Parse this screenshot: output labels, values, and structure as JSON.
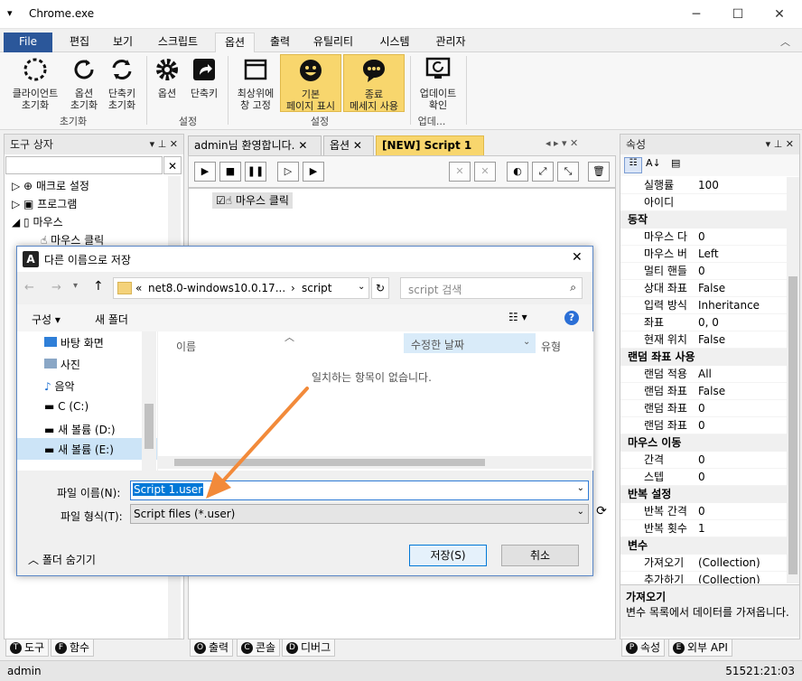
{
  "window": {
    "title": "Chrome.exe",
    "min": "─",
    "max": "☐",
    "close": "✕"
  },
  "menu": {
    "file": "File",
    "tabs": [
      "편집",
      "보기",
      "스크립트",
      "옵션",
      "출력",
      "유틸리티",
      "시스템",
      "관리자"
    ]
  },
  "ribbon": {
    "buttons": [
      {
        "l1": "클라이언트",
        "l2": "초기화"
      },
      {
        "l1": "옵션",
        "l2": "초기화"
      },
      {
        "l1": "단축키",
        "l2": "초기화"
      },
      {
        "l1": "옵션",
        "l2": ""
      },
      {
        "l1": "단축키",
        "l2": ""
      },
      {
        "l1": "최상위에",
        "l2": "창 고정"
      },
      {
        "l1": "기본",
        "l2": "페이지 표시"
      },
      {
        "l1": "종료",
        "l2": "메세지 사용"
      },
      {
        "l1": "업데이트",
        "l2": "확인"
      }
    ],
    "groups": [
      "초기화",
      "설정",
      "설정",
      "업데..."
    ]
  },
  "toolbox": {
    "title": "도구 상자",
    "search_value": "",
    "items": [
      "매크로 설정",
      "프로그램",
      "마우스",
      "마우스 클릭"
    ]
  },
  "doc_tabs": [
    "admin님 환영합니다.",
    "옵션",
    "[NEW] Script 1"
  ],
  "script": {
    "item": "마우스 클릭"
  },
  "properties": {
    "title": "속성",
    "rows": [
      {
        "k": "실행률",
        "v": "100",
        "cat": false
      },
      {
        "k": "아이디",
        "v": "",
        "cat": false
      },
      {
        "k": "동작",
        "v": "",
        "cat": true
      },
      {
        "k": "마우스 다",
        "v": "0",
        "cat": false
      },
      {
        "k": "마우스 버",
        "v": "Left",
        "cat": false
      },
      {
        "k": "멀티 핸들",
        "v": "0",
        "cat": false
      },
      {
        "k": "상대 좌표",
        "v": "False",
        "cat": false
      },
      {
        "k": "입력 방식",
        "v": "Inheritance",
        "cat": false
      },
      {
        "k": "좌표",
        "v": "0, 0",
        "cat": false
      },
      {
        "k": "현재 위치",
        "v": "False",
        "cat": false
      },
      {
        "k": "랜덤 좌표 사용",
        "v": "",
        "cat": true
      },
      {
        "k": "랜덤 적용",
        "v": "All",
        "cat": false
      },
      {
        "k": "랜덤 좌표",
        "v": "False",
        "cat": false
      },
      {
        "k": "랜덤 좌표",
        "v": "0",
        "cat": false
      },
      {
        "k": "랜덤 좌표",
        "v": "0",
        "cat": false
      },
      {
        "k": "마우스 이동",
        "v": "",
        "cat": true
      },
      {
        "k": "간격",
        "v": "0",
        "cat": false
      },
      {
        "k": "스텝",
        "v": "0",
        "cat": false
      },
      {
        "k": "반복 설정",
        "v": "",
        "cat": true
      },
      {
        "k": "반복 간격",
        "v": "0",
        "cat": false
      },
      {
        "k": "반복 횟수",
        "v": "1",
        "cat": false
      },
      {
        "k": "변수",
        "v": "",
        "cat": true
      },
      {
        "k": "가져오기",
        "v": "(Collection)",
        "cat": false
      },
      {
        "k": "추가하기",
        "v": "(Collection)",
        "cat": false
      }
    ],
    "desc_title": "가져오기",
    "desc_text": "변수 목록에서 데이터를 가져옵니다."
  },
  "dialog": {
    "title": "다른 이름으로 저장",
    "path_prefix": "«",
    "path": "net8.0-windows10.0.17...",
    "path_last": "script",
    "search_placeholder": "script 검색",
    "organize": "구성 ▾",
    "new_folder": "새 폴더",
    "nav": [
      "바탕 화면",
      "사진",
      "음악",
      "C (C:)",
      "새 볼륨 (D:)",
      "새 볼륨 (E:)"
    ],
    "col_name": "이름",
    "col_date": "수정한 날짜",
    "col_type": "유형",
    "empty": "일치하는 항목이 없습니다.",
    "filename_label": "파일 이름(N):",
    "filename_value": "Script 1.user",
    "filetype_label": "파일 형식(T):",
    "filetype_value": "Script files (*.user)",
    "hide_folders": "폴더 숨기기",
    "save": "저장(S)",
    "cancel": "취소"
  },
  "bottom_tabs": {
    "left": [
      "도구",
      "함수"
    ],
    "mid": [
      "출력",
      "콘솔",
      "디버그"
    ],
    "right": [
      "속성",
      "외부 API"
    ]
  },
  "status": {
    "user": "admin",
    "time": "51521:21:03"
  },
  "colors": {
    "accent": "#2b579a",
    "highlight": "#f8d66d",
    "arrow": "#f28a3a"
  }
}
